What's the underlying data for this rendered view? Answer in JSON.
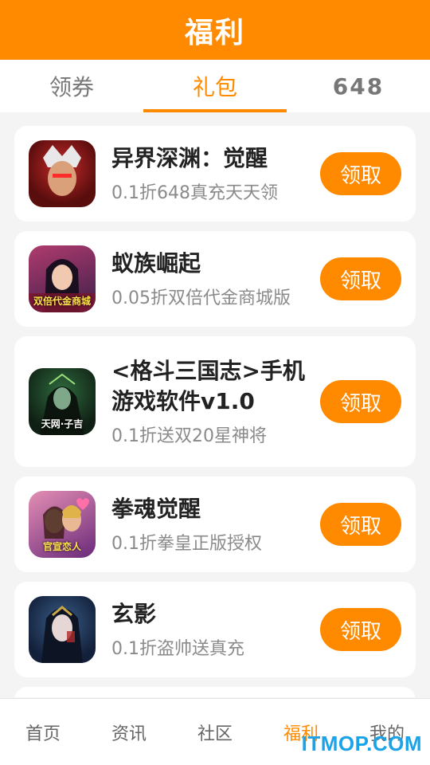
{
  "header": {
    "title": "福利"
  },
  "tabs": [
    {
      "label": "领券"
    },
    {
      "label": "礼包"
    },
    {
      "label": "648"
    }
  ],
  "games": [
    {
      "name": "异界深渊：觉醒",
      "desc": "0.1折648真充天天领",
      "button": "领取",
      "icon": "game-avatar-icon",
      "icon_colors": [
        "#5a0d0d",
        "#c72b2b"
      ],
      "icon_caption": ""
    },
    {
      "name": "蚁族崛起",
      "desc": "0.05折双倍代金商城版",
      "button": "领取",
      "icon": "game-avatar-icon",
      "icon_colors": [
        "#3b1f4a",
        "#b03b6e"
      ],
      "icon_caption": "双倍代金商城"
    },
    {
      "name": "<格斗三国志>手机游戏软件v1.0",
      "desc": "0.1折送双20星神将",
      "button": "领取",
      "icon": "game-avatar-icon",
      "icon_colors": [
        "#0f1f14",
        "#2f6b3d"
      ],
      "icon_caption": "天网·子吉"
    },
    {
      "name": "拳魂觉醒",
      "desc": "0.1折拳皇正版授权",
      "button": "领取",
      "icon": "game-avatar-icon",
      "icon_colors": [
        "#6a2a7a",
        "#e48fb4"
      ],
      "icon_caption": "官宣恋人"
    },
    {
      "name": "玄影",
      "desc": "0.1折盗帅送真充",
      "button": "领取",
      "icon": "game-avatar-icon",
      "icon_colors": [
        "#13203a",
        "#3a5f8a"
      ],
      "icon_caption": ""
    }
  ],
  "bottom_nav": [
    {
      "label": "首页"
    },
    {
      "label": "资讯"
    },
    {
      "label": "社区"
    },
    {
      "label": "福利"
    },
    {
      "label": "我的"
    }
  ],
  "watermark": "ITMOP.COM",
  "colors": {
    "accent": "#ff8a00",
    "watermark": "#1aa3e8"
  }
}
